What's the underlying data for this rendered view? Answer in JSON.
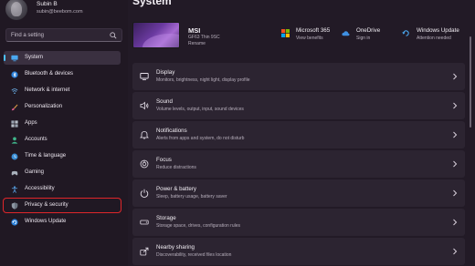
{
  "profile": {
    "name": "Subin B",
    "email": "subin@beebom.com"
  },
  "search": {
    "placeholder": "Find a setting"
  },
  "sidebar": {
    "items": [
      {
        "label": "System",
        "icon": "monitor-icon",
        "active": true
      },
      {
        "label": "Bluetooth & devices",
        "icon": "bluetooth-icon"
      },
      {
        "label": "Network & internet",
        "icon": "network-icon"
      },
      {
        "label": "Personalization",
        "icon": "brush-icon"
      },
      {
        "label": "Apps",
        "icon": "apps-icon"
      },
      {
        "label": "Accounts",
        "icon": "person-icon"
      },
      {
        "label": "Time & language",
        "icon": "globe-clock-icon"
      },
      {
        "label": "Gaming",
        "icon": "gamepad-icon"
      },
      {
        "label": "Accessibility",
        "icon": "accessibility-icon"
      },
      {
        "label": "Privacy & security",
        "icon": "shield-icon",
        "highlighted": true
      },
      {
        "label": "Windows Update",
        "icon": "update-icon"
      }
    ]
  },
  "page": {
    "title": "System"
  },
  "device": {
    "name": "MSI",
    "model": "GF63 Thin 9SC",
    "rename": "Rename"
  },
  "quick_status": [
    {
      "title": "Microsoft 365",
      "sub": "View benefits",
      "icon": "microsoft-logo-icon"
    },
    {
      "title": "OneDrive",
      "sub": "Sign in",
      "icon": "cloud-icon"
    },
    {
      "title": "Windows Update",
      "sub": "Attention needed",
      "icon": "update-icon"
    }
  ],
  "cards": [
    {
      "title": "Display",
      "sub": "Monitors, brightness, night light, display profile",
      "icon": "display-icon"
    },
    {
      "title": "Sound",
      "sub": "Volume levels, output, input, sound devices",
      "icon": "speaker-icon"
    },
    {
      "title": "Notifications",
      "sub": "Alerts from apps and system, do not disturb",
      "icon": "bell-icon"
    },
    {
      "title": "Focus",
      "sub": "Reduce distractions",
      "icon": "focus-icon"
    },
    {
      "title": "Power & battery",
      "sub": "Sleep, battery usage, battery saver",
      "icon": "power-icon"
    },
    {
      "title": "Storage",
      "sub": "Storage space, drives, configuration rules",
      "icon": "storage-icon"
    },
    {
      "title": "Nearby sharing",
      "sub": "Discoverability, received files location",
      "icon": "share-icon"
    }
  ],
  "colors": {
    "accent": "#4cc2ff",
    "highlight": "#e0262a",
    "background": "#221a26"
  }
}
